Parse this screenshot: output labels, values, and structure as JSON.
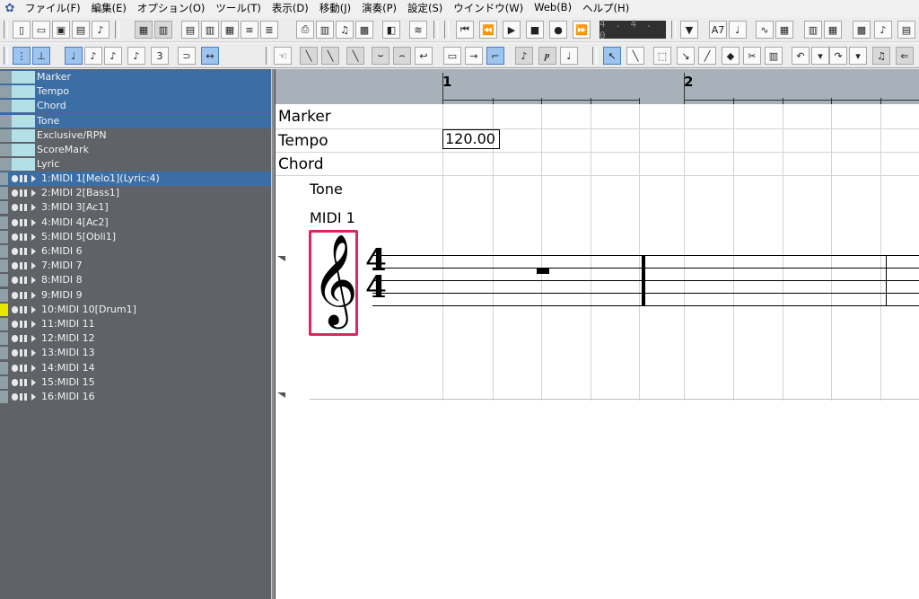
{
  "menu": [
    "ファイル(F)",
    "編集(E)",
    "オプション(O)",
    "ツール(T)",
    "表示(D)",
    "移動(J)",
    "演奏(P)",
    "設定(S)",
    "ウインドウ(W)",
    "Web(B)",
    "ヘルプ(H)"
  ],
  "transport": {
    "position": "4 . 4 .  0"
  },
  "tracks": {
    "special": [
      {
        "label": "Marker",
        "selected": true
      },
      {
        "label": "Tempo",
        "selected": true
      },
      {
        "label": "Chord",
        "selected": true
      },
      {
        "label": "Tone",
        "selected": true
      },
      {
        "label": "Exclusive/RPN",
        "selected": false
      },
      {
        "label": "ScoreMark",
        "selected": false
      },
      {
        "label": "Lyric",
        "selected": false
      }
    ],
    "midi": [
      {
        "label": "1:MIDI 1[Melo1](Lyric:4)",
        "selected": true
      },
      {
        "label": "2:MIDI 2[Bass1]",
        "selected": false
      },
      {
        "label": "3:MIDI 3[Ac1]",
        "selected": false
      },
      {
        "label": "4:MIDI 4[Ac2]",
        "selected": false
      },
      {
        "label": "5:MIDI 5[Obli1]",
        "selected": false
      },
      {
        "label": "6:MIDI 6",
        "selected": false
      },
      {
        "label": "7:MIDI 7",
        "selected": false
      },
      {
        "label": "8:MIDI 8",
        "selected": false
      },
      {
        "label": "9:MIDI 9",
        "selected": false
      },
      {
        "label": "10:MIDI 10[Drum1]",
        "selected": false
      },
      {
        "label": "11:MIDI 11",
        "selected": false
      },
      {
        "label": "12:MIDI 12",
        "selected": false
      },
      {
        "label": "13:MIDI 13",
        "selected": false
      },
      {
        "label": "14:MIDI 14",
        "selected": false
      },
      {
        "label": "15:MIDI 15",
        "selected": false
      },
      {
        "label": "16:MIDI 16",
        "selected": false
      }
    ]
  },
  "score": {
    "measures": [
      "1",
      "2"
    ],
    "rows": {
      "marker": "Marker",
      "tempo": "Tempo",
      "chord": "Chord"
    },
    "tempo_value": "120.00",
    "tone_label": "Tone",
    "staff_label": "MIDI 1",
    "time_signature": {
      "top": "4",
      "bottom": "4"
    },
    "clef_glyph": "𝄞",
    "rest_type": "whole-rest"
  },
  "colors": {
    "selection": "#3b6ea5",
    "highlight_box": "#e0245e",
    "panel_bg": "#5f6266",
    "ruler_bg": "#a8b0b9",
    "drum_marker": "#e6e600"
  },
  "icons": [
    "app-icon",
    "new-file-icon",
    "open-folder-icon",
    "save-icon",
    "play-icon",
    "stop-icon",
    "record-icon",
    "rewind-icon",
    "fast-forward-icon",
    "pointer-tool-icon",
    "pencil-tool-icon",
    "eraser-tool-icon",
    "undo-icon",
    "redo-icon"
  ]
}
